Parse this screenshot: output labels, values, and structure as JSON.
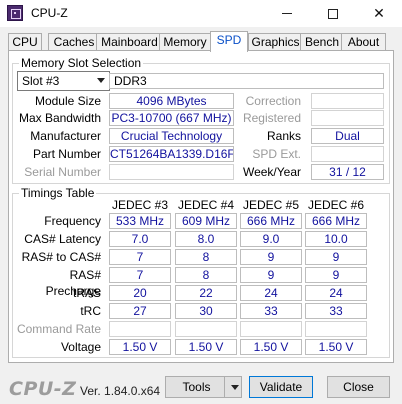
{
  "window": {
    "title": "CPU-Z"
  },
  "tabs": [
    {
      "label": "CPU"
    },
    {
      "label": "Caches"
    },
    {
      "label": "Mainboard"
    },
    {
      "label": "Memory"
    },
    {
      "label": "SPD"
    },
    {
      "label": "Graphics"
    },
    {
      "label": "Bench"
    },
    {
      "label": "About"
    }
  ],
  "active_tab": "SPD",
  "slot": {
    "group_title": "Memory Slot Selection",
    "selected": "Slot #3",
    "type": "DDR3",
    "module_size_label": "Module Size",
    "module_size": "4096 MBytes",
    "max_bandwidth_label": "Max Bandwidth",
    "max_bandwidth": "PC3-10700 (667 MHz)",
    "manufacturer_label": "Manufacturer",
    "manufacturer": "Crucial Technology",
    "part_number_label": "Part Number",
    "part_number": "CT51264BA1339.D16F",
    "serial_number_label": "Serial Number",
    "serial_number": "",
    "correction_label": "Correction",
    "correction": "",
    "registered_label": "Registered",
    "registered": "",
    "ranks_label": "Ranks",
    "ranks": "Dual",
    "spd_ext_label": "SPD Ext.",
    "spd_ext": "",
    "week_year_label": "Week/Year",
    "week_year": "31 / 12"
  },
  "timings": {
    "group_title": "Timings Table",
    "columns": [
      "JEDEC #3",
      "JEDEC #4",
      "JEDEC #5",
      "JEDEC #6"
    ],
    "rows": [
      {
        "label": "Frequency",
        "values": [
          "533 MHz",
          "609 MHz",
          "666 MHz",
          "666 MHz"
        ]
      },
      {
        "label": "CAS# Latency",
        "values": [
          "7.0",
          "8.0",
          "9.0",
          "10.0"
        ]
      },
      {
        "label": "RAS# to CAS#",
        "values": [
          "7",
          "8",
          "9",
          "9"
        ]
      },
      {
        "label": "RAS# Precharge",
        "values": [
          "7",
          "8",
          "9",
          "9"
        ]
      },
      {
        "label": "tRAS",
        "values": [
          "20",
          "22",
          "24",
          "24"
        ]
      },
      {
        "label": "tRC",
        "values": [
          "27",
          "30",
          "33",
          "33"
        ]
      },
      {
        "label": "Command Rate",
        "values": [
          "",
          "",
          "",
          ""
        ]
      },
      {
        "label": "Voltage",
        "values": [
          "1.50 V",
          "1.50 V",
          "1.50 V",
          "1.50 V"
        ]
      }
    ]
  },
  "footer": {
    "brand": "CPU-Z",
    "version": "Ver. 1.84.0.x64",
    "tools_label": "Tools",
    "validate_label": "Validate",
    "close_label": "Close"
  },
  "colors": {
    "value_text": "#12129e",
    "active_tab_text": "#0a50c8",
    "disabled_label": "#9a9a9a"
  }
}
